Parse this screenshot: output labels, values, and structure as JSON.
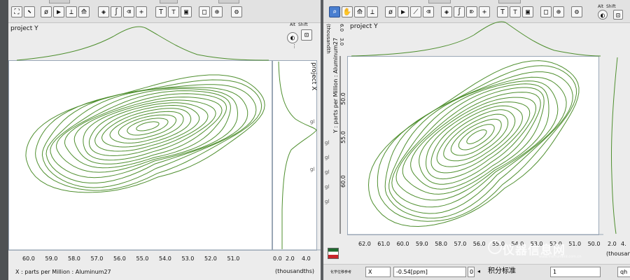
{
  "colors": {
    "contour": "#4f8f2f",
    "plot_background": "#ffffff",
    "toolbar": "#e2e2e2"
  },
  "toolbar": {
    "icons": [
      "select-arrow-icon",
      "zoom-magnifier-icon",
      "pan-hand-icon",
      "phi-tool-icon",
      "pointer-icon",
      "baseline-icon",
      "eraser-icon",
      "peak-pick-icon",
      "integral-icon",
      "erase-icon",
      "add-icon",
      "text-tool-icon",
      "label-tool-icon",
      "box-tool-icon",
      "crosshair-icon",
      "settings-icon"
    ],
    "alt_label": "Alt",
    "shift_label": "Shift"
  },
  "left": {
    "projection_y_label": "project Y",
    "projection_x_label": "project X",
    "x_ticks": [
      "60.0",
      "59.0",
      "58.0",
      "57.0",
      "56.0",
      "55.0",
      "54.0",
      "53.0",
      "52.0",
      "51.0"
    ],
    "x_axis_title": "X : parts per Million : Aluminum27",
    "side_ticks": [
      "0.0",
      "2.0",
      "4.0"
    ],
    "side_unit": "(thousandths)",
    "side_glyphs": [
      "gl",
      "gl"
    ]
  },
  "right": {
    "projection_y_label": "project Y",
    "proj_axis_ticks": [
      "3.0",
      "6.0"
    ],
    "proj_axis_unit": "(thousandth",
    "y_axis_title": "Y : parts per Million : Aluminum27",
    "y_ticks": [
      "50.0",
      "55.0",
      "60.0"
    ],
    "x_ticks": [
      "62.0",
      "61.0",
      "60.0",
      "59.0",
      "58.0",
      "57.0",
      "56.0",
      "55.0",
      "54.0",
      "53.0",
      "52.0",
      "51.0",
      "50.0"
    ],
    "side_ticks": [
      "2.0",
      "4."
    ],
    "side_unit": "(thousand",
    "left_glyphs": [
      "gl",
      "gl",
      "gl",
      "gl",
      "gl"
    ],
    "bottom": {
      "small_label": "化学位移参考",
      "axis_value": "X",
      "shift_value": "-0.54[ppm]",
      "zero": "0",
      "integral_standard": "积分标准",
      "field_value": "1",
      "tail": "qh"
    }
  },
  "watermark": {
    "text": "仪器信息网",
    "sub": "www.instrument.com.cn"
  }
}
